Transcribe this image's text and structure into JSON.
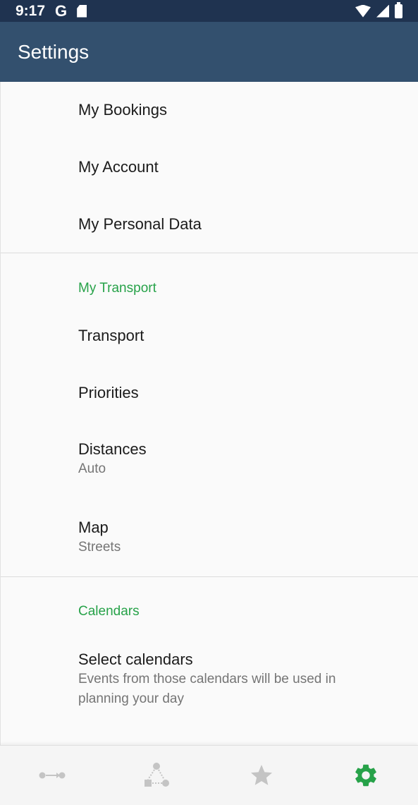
{
  "status_bar": {
    "time": "9:17",
    "g_label": "G",
    "icons": [
      "sd-card-icon",
      "wifi-icon",
      "signal-icon",
      "battery-icon"
    ]
  },
  "app_bar": {
    "title": "Settings"
  },
  "account_items": [
    {
      "title": "My Bookings"
    },
    {
      "title": "My Account"
    },
    {
      "title": "My Personal Data"
    }
  ],
  "transport_section": {
    "header": "My Transport",
    "items": [
      {
        "title": "Transport"
      },
      {
        "title": "Priorities"
      },
      {
        "title": "Distances",
        "subtitle": "Auto"
      },
      {
        "title": "Map",
        "subtitle": "Streets"
      }
    ]
  },
  "calendars_section": {
    "header": "Calendars",
    "items": [
      {
        "title": "Select calendars",
        "subtitle": "Events from those calendars will be used in planning your day"
      }
    ]
  },
  "bottom_nav": {
    "items": [
      {
        "icon": "route-icon",
        "active": false
      },
      {
        "icon": "network-icon",
        "active": false
      },
      {
        "icon": "star-icon",
        "active": false
      },
      {
        "icon": "gear-icon",
        "active": true
      }
    ]
  },
  "colors": {
    "status_bar": "#1f3350",
    "app_bar": "#33506e",
    "accent_green": "#27a249",
    "inactive_icon": "#c4c4c4",
    "background": "#fafafa"
  }
}
